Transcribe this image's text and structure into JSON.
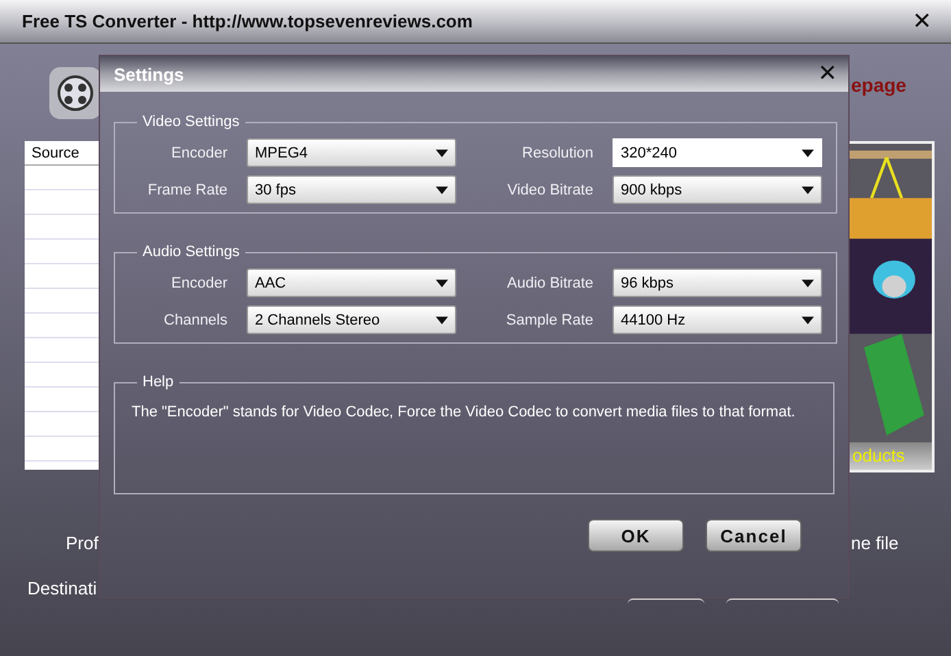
{
  "window": {
    "title": "Free TS Converter - http://www.topsevenreviews.com",
    "close": "✕"
  },
  "background": {
    "link_fragment": "epage",
    "source_header": "Source",
    "ad_caption": "oducts",
    "profile_label": "Prof",
    "destination_label": "Destinati",
    "merge_label": "ne file"
  },
  "dialog": {
    "title": "Settings",
    "close": "✕",
    "groups": [
      {
        "title": "Video Settings",
        "fields": [
          {
            "label": "Encoder",
            "value": "MPEG4",
            "kind": "dropdown"
          },
          {
            "label": "Resolution",
            "value": "320*240",
            "kind": "combo"
          },
          {
            "label": "Frame Rate",
            "value": "30 fps",
            "kind": "dropdown"
          },
          {
            "label": "Video Bitrate",
            "value": "900 kbps",
            "kind": "dropdown"
          }
        ]
      },
      {
        "title": "Audio Settings",
        "fields": [
          {
            "label": "Encoder",
            "value": "AAC",
            "kind": "dropdown"
          },
          {
            "label": "Audio Bitrate",
            "value": "96 kbps",
            "kind": "dropdown"
          },
          {
            "label": "Channels",
            "value": "2 Channels Stereo",
            "kind": "dropdown"
          },
          {
            "label": "Sample Rate",
            "value": "44100 Hz",
            "kind": "dropdown"
          }
        ]
      }
    ],
    "help": {
      "title": "Help",
      "text": "The \"Encoder\" stands for Video Codec, Force the Video Codec to convert media files to that format."
    },
    "buttons": [
      "OK",
      "Cancel"
    ]
  }
}
